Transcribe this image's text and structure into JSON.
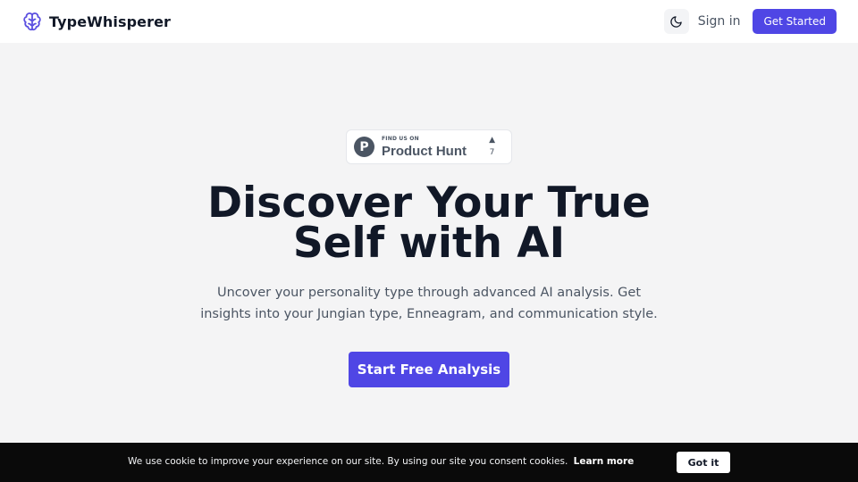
{
  "header": {
    "brand_name": "TypeWhisperer",
    "brand_icon": "brain-icon",
    "theme_icon": "moon-icon",
    "signin_label": "Sign in",
    "get_started_label": "Get Started"
  },
  "product_hunt": {
    "logo_letter": "P",
    "small_text": "FIND US ON",
    "big_text": "Product Hunt",
    "upvote_arrow": "▲",
    "upvote_count": "7"
  },
  "hero": {
    "title_line1": "Discover Your True",
    "title_line2": "Self with AI",
    "subtitle": "Uncover your personality type through advanced AI analysis. Get insights into your Jungian type, Enneagram, and communication style.",
    "cta_label": "Start Free Analysis"
  },
  "cookie_bar": {
    "message": "We use cookie to improve your experience on our site. By using our site you consent cookies.",
    "link_label": "Learn more",
    "button_label": "Got it"
  },
  "colors": {
    "accent": "#4f46e5",
    "page_background": "#f4f4f5",
    "cookie_bar_background": "#0a0a0a"
  }
}
